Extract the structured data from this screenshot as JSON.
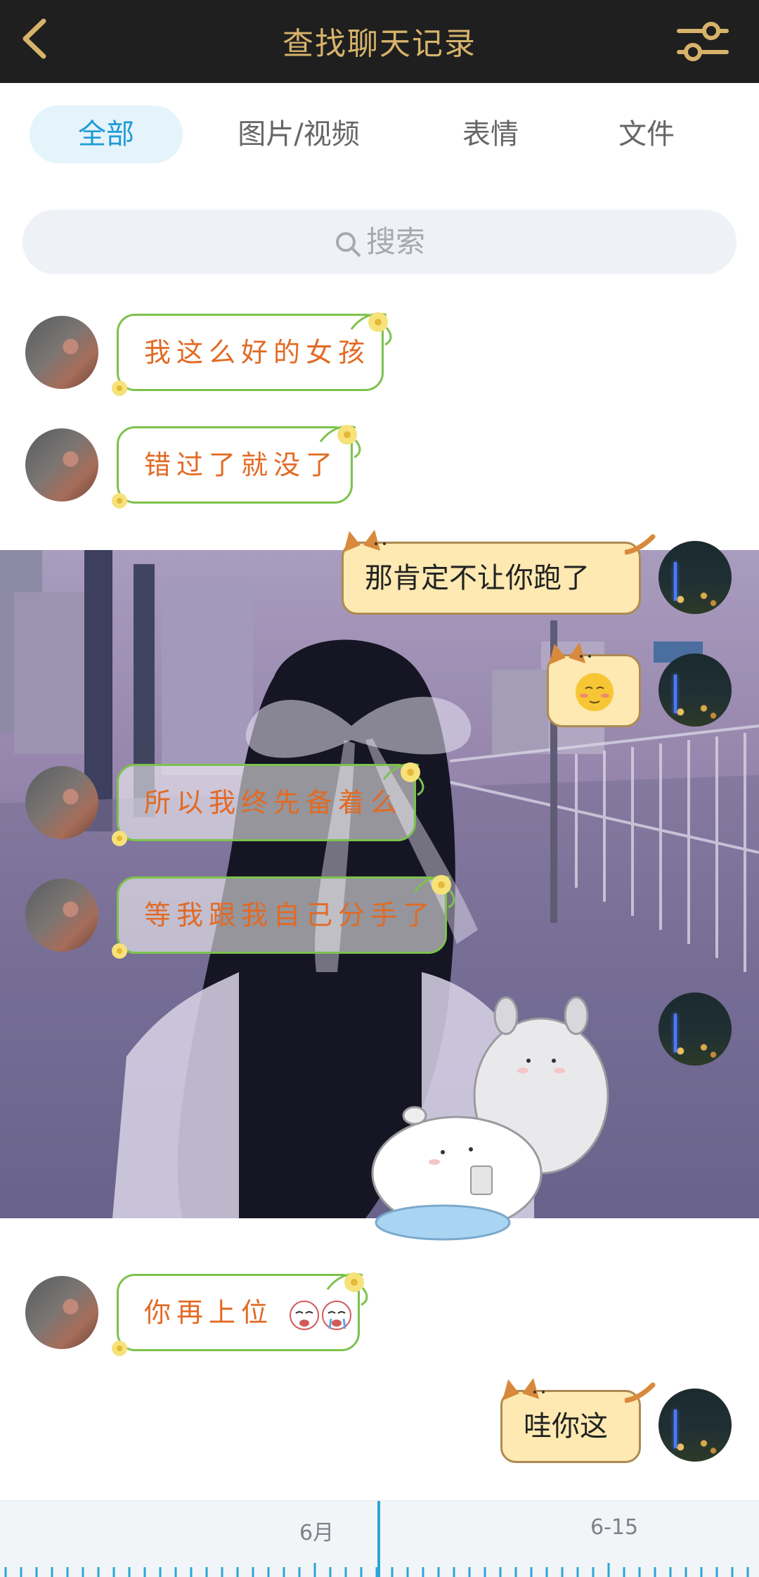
{
  "header": {
    "title": "查找聊天记录",
    "back_icon": "chevron-left-icon",
    "filter_icon": "sliders-icon"
  },
  "tabs": [
    {
      "label": "全部",
      "active": true
    },
    {
      "label": "图片/视频",
      "active": false
    },
    {
      "label": "表情",
      "active": false
    },
    {
      "label": "文件",
      "active": false
    }
  ],
  "search": {
    "placeholder": "搜索",
    "icon": "search-icon"
  },
  "messages": [
    {
      "side": "left",
      "text": "我这么好的女孩"
    },
    {
      "side": "left",
      "text": "错过了就没了"
    },
    {
      "side": "right",
      "text": "那肯定不让你跑了"
    },
    {
      "side": "right",
      "emoji": "blushing-face-emoji"
    },
    {
      "side": "left",
      "text": "所以我终先备着么"
    },
    {
      "side": "left",
      "text": "等我跟我自己分手了"
    },
    {
      "side": "right",
      "sticker": "chinchilla-sticker"
    },
    {
      "side": "left",
      "text": "你再上位",
      "emoji": "crying-face-emoji"
    },
    {
      "side": "right",
      "text": "哇你这"
    }
  ],
  "timeline": {
    "labels": [
      "6月",
      "6-15"
    ]
  },
  "colors": {
    "header_bg": "#1f1f1f",
    "header_accent": "#d7b36a",
    "tab_active": "#1f9bd6",
    "bubble_text": "#e26a24",
    "bubble_border": "#7cc24c",
    "cat_bubble": "#fde9b1",
    "timeline_marker": "#2aa6d6"
  }
}
